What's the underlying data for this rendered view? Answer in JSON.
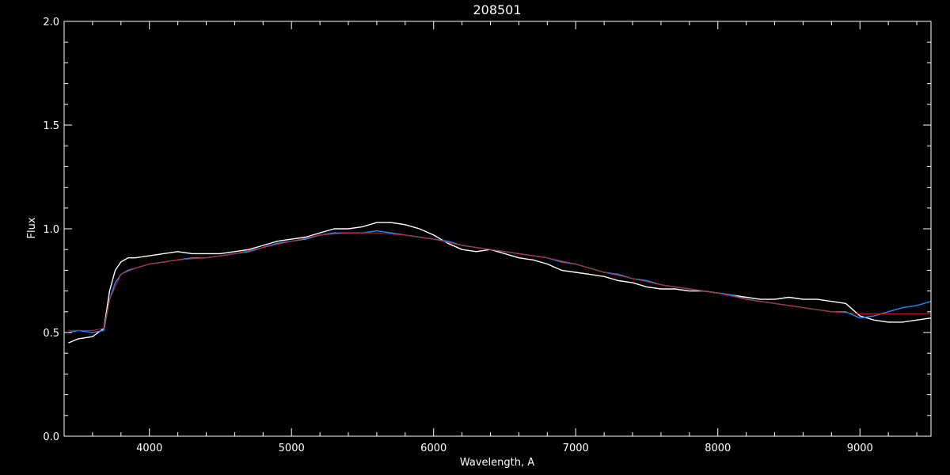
{
  "chart_data": {
    "type": "line",
    "title": "208501",
    "xlabel": "Wavelength, A",
    "ylabel": "Flux",
    "xlim": [
      3400,
      9500
    ],
    "ylim": [
      0.0,
      2.0
    ],
    "x_ticks": [
      4000,
      5000,
      6000,
      7000,
      8000,
      9000
    ],
    "x_tick_labels": [
      "4000",
      "5000",
      "6000",
      "7000",
      "8000",
      "9000"
    ],
    "y_ticks": [
      0.0,
      0.5,
      1.0,
      1.5,
      2.0
    ],
    "y_tick_labels": [
      "0.0",
      "0.5",
      "1.0",
      "1.5",
      "2.0"
    ],
    "grid": false,
    "background": "#000000",
    "series": [
      {
        "color": "#ffffff",
        "x": [
          3430,
          3500,
          3600,
          3680,
          3720,
          3760,
          3800,
          3850,
          3900,
          4000,
          4100,
          4200,
          4300,
          4400,
          4500,
          4600,
          4700,
          4800,
          4900,
          5000,
          5100,
          5200,
          5300,
          5400,
          5500,
          5600,
          5700,
          5800,
          5900,
          6000,
          6100,
          6200,
          6300,
          6400,
          6500,
          6600,
          6700,
          6800,
          6900,
          7000,
          7100,
          7200,
          7300,
          7400,
          7500,
          7600,
          7700,
          7800,
          7900,
          8000,
          8100,
          8200,
          8300,
          8400,
          8500,
          8600,
          8700,
          8800,
          8900,
          9000,
          9100,
          9200,
          9300,
          9400,
          9500
        ],
        "y": [
          0.45,
          0.47,
          0.48,
          0.52,
          0.7,
          0.8,
          0.84,
          0.86,
          0.86,
          0.87,
          0.88,
          0.89,
          0.88,
          0.88,
          0.88,
          0.89,
          0.9,
          0.92,
          0.94,
          0.95,
          0.96,
          0.98,
          1.0,
          1.0,
          1.01,
          1.03,
          1.03,
          1.02,
          1.0,
          0.97,
          0.93,
          0.9,
          0.89,
          0.9,
          0.88,
          0.86,
          0.85,
          0.83,
          0.8,
          0.79,
          0.78,
          0.77,
          0.75,
          0.74,
          0.72,
          0.71,
          0.71,
          0.7,
          0.7,
          0.69,
          0.68,
          0.67,
          0.66,
          0.66,
          0.67,
          0.66,
          0.66,
          0.65,
          0.64,
          0.58,
          0.56,
          0.55,
          0.55,
          0.56,
          0.57
        ]
      },
      {
        "color": "#1e8cff",
        "x": [
          3430,
          3500,
          3600,
          3680,
          3720,
          3760,
          3800,
          3850,
          3900,
          4000,
          4100,
          4200,
          4300,
          4400,
          4500,
          4600,
          4700,
          4800,
          4900,
          5000,
          5100,
          5200,
          5300,
          5400,
          5500,
          5600,
          5700,
          5800,
          5900,
          6000,
          6100,
          6200,
          6300,
          6400,
          6500,
          6600,
          6700,
          6800,
          6900,
          7000,
          7100,
          7200,
          7300,
          7400,
          7500,
          7600,
          7700,
          7800,
          7900,
          8000,
          8100,
          8200,
          8300,
          8400,
          8500,
          8600,
          8700,
          8800,
          8900,
          9000,
          9100,
          9200,
          9300,
          9400,
          9500
        ],
        "y": [
          0.5,
          0.51,
          0.5,
          0.51,
          0.66,
          0.74,
          0.78,
          0.8,
          0.81,
          0.83,
          0.84,
          0.85,
          0.86,
          0.86,
          0.87,
          0.88,
          0.89,
          0.91,
          0.93,
          0.94,
          0.95,
          0.97,
          0.98,
          0.98,
          0.98,
          0.99,
          0.98,
          0.97,
          0.96,
          0.95,
          0.94,
          0.92,
          0.91,
          0.9,
          0.89,
          0.88,
          0.87,
          0.86,
          0.84,
          0.83,
          0.81,
          0.79,
          0.78,
          0.76,
          0.75,
          0.73,
          0.72,
          0.71,
          0.7,
          0.69,
          0.68,
          0.66,
          0.65,
          0.64,
          0.63,
          0.62,
          0.61,
          0.6,
          0.6,
          0.57,
          0.58,
          0.6,
          0.62,
          0.63,
          0.65
        ]
      },
      {
        "color": "#cc2222",
        "x": [
          3430,
          3600,
          3680,
          3720,
          3800,
          3900,
          4000,
          4200,
          4400,
          4600,
          4800,
          5000,
          5200,
          5400,
          5600,
          5800,
          6000,
          6200,
          6400,
          6600,
          6800,
          7000,
          7200,
          7400,
          7600,
          7800,
          8000,
          8200,
          8400,
          8600,
          8800,
          9000,
          9200,
          9400,
          9500
        ],
        "y": [
          0.51,
          0.51,
          0.52,
          0.66,
          0.78,
          0.81,
          0.83,
          0.85,
          0.86,
          0.88,
          0.91,
          0.94,
          0.97,
          0.98,
          0.98,
          0.97,
          0.95,
          0.92,
          0.9,
          0.88,
          0.86,
          0.83,
          0.79,
          0.76,
          0.73,
          0.71,
          0.69,
          0.66,
          0.64,
          0.62,
          0.6,
          0.59,
          0.59,
          0.59,
          0.59
        ]
      }
    ]
  }
}
